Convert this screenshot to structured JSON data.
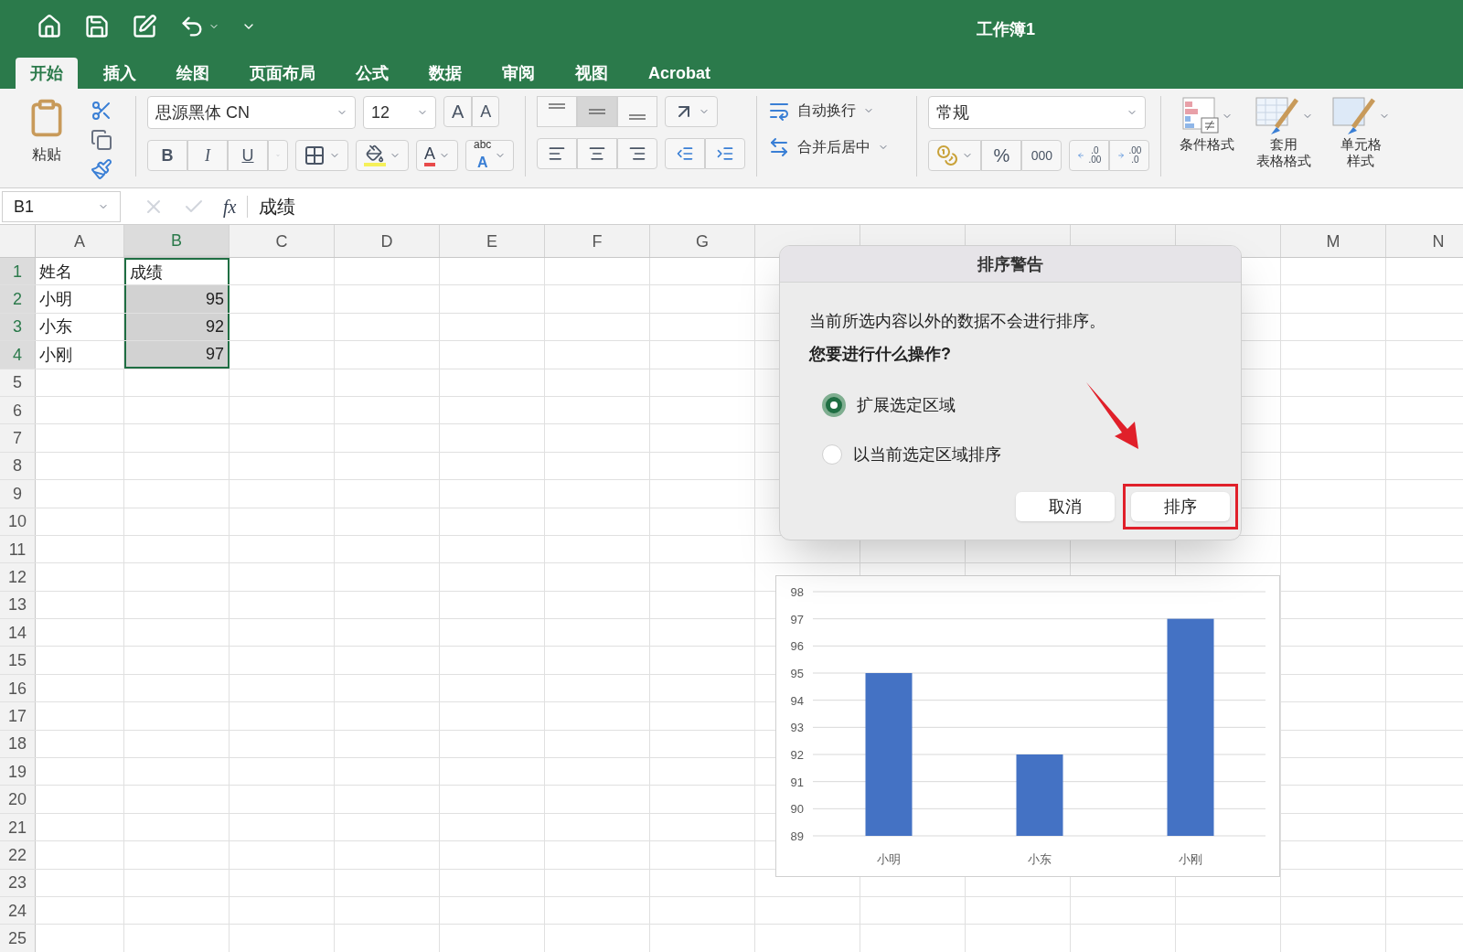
{
  "window": {
    "title": "工作簿1"
  },
  "tabs": [
    {
      "label": "开始",
      "selected": true
    },
    {
      "label": "插入",
      "selected": false
    },
    {
      "label": "绘图",
      "selected": false
    },
    {
      "label": "页面布局",
      "selected": false
    },
    {
      "label": "公式",
      "selected": false
    },
    {
      "label": "数据",
      "selected": false
    },
    {
      "label": "审阅",
      "selected": false
    },
    {
      "label": "视图",
      "selected": false
    },
    {
      "label": "Acrobat",
      "selected": false
    }
  ],
  "ribbon": {
    "paste": "粘贴",
    "font": "思源黑体 CN",
    "font_size": "12",
    "grow_font": "A",
    "shrink_font": "A",
    "bold": "B",
    "italic": "I",
    "underline": "U",
    "font_color": "A",
    "phonetic_top": "abc",
    "phonetic_bottom": "A",
    "vertical_align": [
      {
        "selected": false
      },
      {
        "selected": true
      },
      {
        "selected": false
      }
    ],
    "wrap_text": "自动换行",
    "merge_center": "合并后居中",
    "number_format": "常规",
    "percent": "%",
    "thousands": "000",
    "increase_decimal": [
      ".0",
      ".00"
    ],
    "decrease_decimal": [
      ".00",
      ".0"
    ],
    "styles": [
      {
        "lines": [
          "条件格式"
        ],
        "kind": "conditional"
      },
      {
        "lines": [
          "套用",
          "表格格式"
        ],
        "kind": "table"
      },
      {
        "lines": [
          "单元格",
          "样式"
        ],
        "kind": "cell"
      }
    ]
  },
  "formula_bar": {
    "name_box": "B1",
    "fx": "fx",
    "value": "成绩"
  },
  "sheet": {
    "columns": [
      {
        "label": "A",
        "selected": false
      },
      {
        "label": "B",
        "selected": true
      },
      {
        "label": "C",
        "selected": false
      },
      {
        "label": "D",
        "selected": false
      },
      {
        "label": "E",
        "selected": false
      },
      {
        "label": "F",
        "selected": false
      },
      {
        "label": "G",
        "selected": false
      },
      {
        "selected": false
      },
      {
        "selected": false
      },
      {
        "selected": false
      },
      {
        "selected": false
      },
      {
        "selected": false
      },
      {
        "label": "M",
        "selected": false
      },
      {
        "label": "N",
        "selected": false
      }
    ],
    "rows": [
      {
        "label": "1",
        "selected": true,
        "cells": [
          {
            "text": "姓名",
            "kind": "text",
            "selected": false
          },
          {
            "text": "成绩",
            "kind": "text",
            "selected": false
          }
        ]
      },
      {
        "label": "2",
        "selected": true,
        "cells": [
          {
            "text": "小明",
            "kind": "text",
            "selected": false
          },
          {
            "text": "95",
            "kind": "number",
            "selected": true
          }
        ]
      },
      {
        "label": "3",
        "selected": true,
        "cells": [
          {
            "text": "小东",
            "kind": "text",
            "selected": false
          },
          {
            "text": "92",
            "kind": "number",
            "selected": true
          }
        ]
      },
      {
        "label": "4",
        "selected": true,
        "cells": [
          {
            "text": "小刚",
            "kind": "text",
            "selected": false
          },
          {
            "text": "97",
            "kind": "number",
            "selected": true
          }
        ]
      },
      {
        "label": "5",
        "selected": false,
        "cells": []
      },
      {
        "label": "6",
        "selected": false,
        "cells": []
      },
      {
        "label": "7",
        "selected": false,
        "cells": []
      },
      {
        "label": "8",
        "selected": false,
        "cells": []
      },
      {
        "label": "9",
        "selected": false,
        "cells": []
      },
      {
        "label": "10",
        "selected": false,
        "cells": []
      },
      {
        "label": "11",
        "selected": false,
        "cells": []
      },
      {
        "label": "12",
        "selected": false,
        "cells": []
      },
      {
        "label": "13",
        "selected": false,
        "cells": []
      },
      {
        "label": "14",
        "selected": false,
        "cells": []
      },
      {
        "label": "15",
        "selected": false,
        "cells": []
      },
      {
        "label": "16",
        "selected": false,
        "cells": []
      },
      {
        "label": "17",
        "selected": false,
        "cells": []
      },
      {
        "label": "18",
        "selected": false,
        "cells": []
      },
      {
        "label": "19",
        "selected": false,
        "cells": []
      },
      {
        "label": "20",
        "selected": false,
        "cells": []
      },
      {
        "label": "21",
        "selected": false,
        "cells": []
      },
      {
        "label": "22",
        "selected": false,
        "cells": []
      },
      {
        "label": "23",
        "selected": false,
        "cells": []
      },
      {
        "label": "24",
        "selected": false,
        "cells": []
      },
      {
        "label": "25",
        "selected": false,
        "cells": []
      }
    ]
  },
  "dialog": {
    "title": "排序警告",
    "message": "当前所选内容以外的数据不会进行排序。",
    "question": "您要进行什么操作?",
    "options": [
      {
        "label": "扩展选定区域",
        "selected": true
      },
      {
        "label": "以当前选定区域排序",
        "selected": false
      }
    ],
    "buttons": [
      {
        "label": "取消",
        "annotated": false
      },
      {
        "label": "排序",
        "annotated": true
      }
    ]
  },
  "chart": {
    "chart_data": {
      "type": "bar",
      "categories": [
        "小明",
        "小东",
        "小刚"
      ],
      "series": [
        {
          "color": "#4472c4",
          "values": [
            95,
            92,
            97
          ]
        }
      ],
      "grid": true,
      "ylim": [
        89,
        98
      ],
      "yticks": [
        89,
        90,
        91,
        92,
        93,
        94,
        95,
        96,
        97,
        98
      ]
    }
  }
}
